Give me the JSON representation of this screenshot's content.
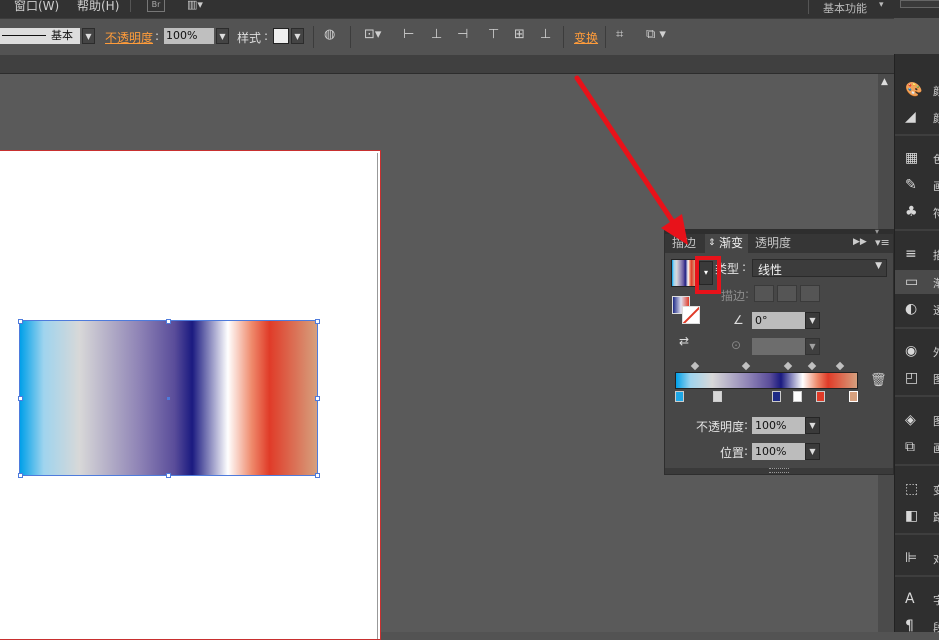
{
  "menubar": {
    "items": [
      "窗口(W)",
      "帮助(H)"
    ],
    "br_label": "Br",
    "workspace_label": "基本功能"
  },
  "control_bar": {
    "stroke_style": "基本",
    "opacity_label": "不透明度",
    "opacity_value": "100%",
    "style_label": "样式",
    "transform_label": "变换"
  },
  "gradient_panel": {
    "tabs": [
      "描边",
      "渐变",
      "透明度"
    ],
    "active_tab": "渐变",
    "type_label": "类型",
    "type_value": "线性",
    "stroke_label": "描边",
    "angle_value": "0°",
    "opacity_label": "不透明度",
    "opacity_value": "100%",
    "location_label": "位置",
    "location_value": "100%",
    "stops": [
      {
        "pos": 0.0,
        "color": "#1ea7e6"
      },
      {
        "pos": 0.22,
        "color": "#d8d8d8"
      },
      {
        "pos": 0.56,
        "color": "#1e2a86"
      },
      {
        "pos": 0.68,
        "color": "#ffffff"
      },
      {
        "pos": 0.81,
        "color": "#e03b28"
      },
      {
        "pos": 1.0,
        "color": "#d6a07e"
      }
    ],
    "midpoints": [
      0.11,
      0.39,
      0.62,
      0.75,
      0.9
    ]
  },
  "gradient_css": "linear-gradient(90deg,#00a0e9 0%,#9fd4ee 8%,#d8d8d8 20%,#8f84b6 40%,#5a4d9a 52%,#1a1a80 58%,#ffffff 70%,#ef8a6c 78%,#e03b28 84%,#d6a07e 100%)",
  "dock": {
    "items": [
      {
        "icon": "palette-icon",
        "label": "颜色"
      },
      {
        "icon": "color-guide-icon",
        "label": "颜色参考"
      },
      {
        "icon": "swatches-icon",
        "label": "色板"
      },
      {
        "icon": "brushes-icon",
        "label": "画笔"
      },
      {
        "icon": "symbols-icon",
        "label": "符号"
      },
      {
        "icon": "stroke-icon",
        "label": "描边"
      },
      {
        "icon": "gradient-icon",
        "label": "渐变"
      },
      {
        "icon": "transparency-icon",
        "label": "透明度"
      },
      {
        "icon": "appearance-icon",
        "label": "外观"
      },
      {
        "icon": "graphic-styles-icon",
        "label": "图形样式"
      },
      {
        "icon": "layers-icon",
        "label": "图层"
      },
      {
        "icon": "artboards-icon",
        "label": "画板"
      },
      {
        "icon": "transform-icon",
        "label": "变换"
      },
      {
        "icon": "pathfinder-icon",
        "label": "路径查找器"
      },
      {
        "icon": "align-icon",
        "label": "对齐"
      },
      {
        "icon": "character-icon",
        "label": "字符"
      },
      {
        "icon": "paragraph-icon",
        "label": "段落"
      }
    ]
  }
}
